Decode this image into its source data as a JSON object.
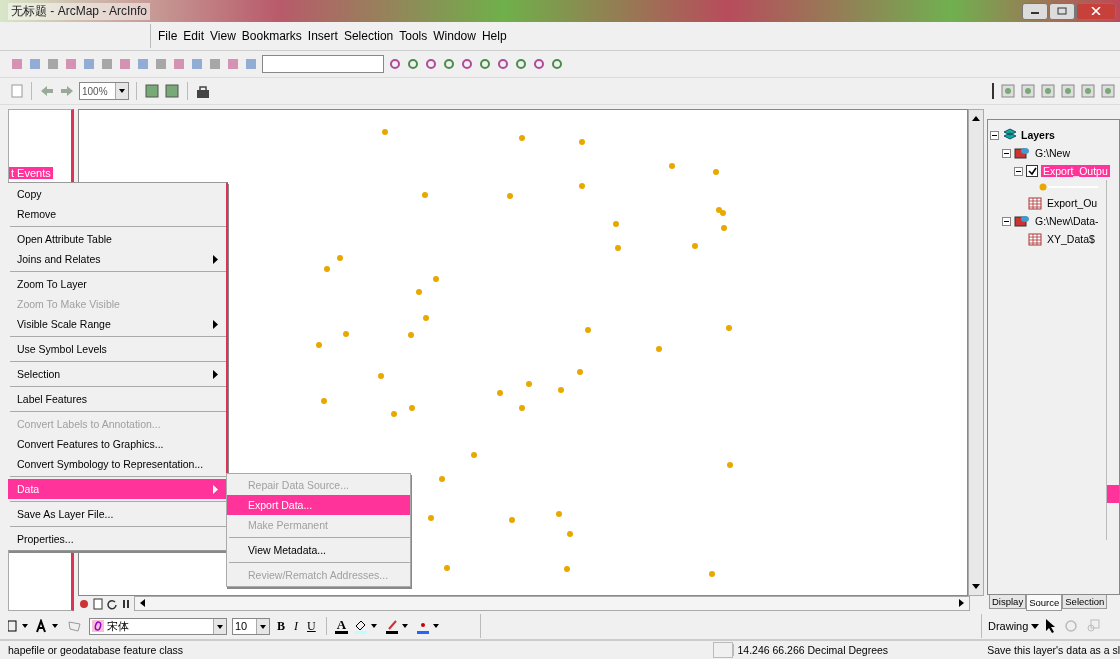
{
  "window": {
    "title": "无标题 - ArcMap - ArcInfo"
  },
  "menu_bar": [
    {
      "label": "File"
    },
    {
      "label": "Edit"
    },
    {
      "label": "View"
    },
    {
      "label": "Bookmarks"
    },
    {
      "label": "Insert"
    },
    {
      "label": "Selection"
    },
    {
      "label": "Tools"
    },
    {
      "label": "Window"
    },
    {
      "label": "Help"
    }
  ],
  "layout_toolbar": {
    "zoom_percent": "100%"
  },
  "left_toc": {
    "item": "t Events",
    "selected": true
  },
  "context_menu": [
    {
      "kind": "item",
      "label": "Copy",
      "disabled": false,
      "submenu": false,
      "selected": false
    },
    {
      "kind": "item",
      "label": "Remove",
      "disabled": false,
      "submenu": false,
      "selected": false
    },
    {
      "kind": "separator"
    },
    {
      "kind": "item",
      "label": "Open Attribute Table",
      "disabled": false,
      "submenu": false,
      "selected": false
    },
    {
      "kind": "item",
      "label": "Joins and Relates",
      "disabled": false,
      "submenu": true,
      "selected": false
    },
    {
      "kind": "separator"
    },
    {
      "kind": "item",
      "label": "Zoom To Layer",
      "disabled": false,
      "submenu": false,
      "selected": false
    },
    {
      "kind": "item",
      "label": "Zoom To Make Visible",
      "disabled": true,
      "submenu": false,
      "selected": false
    },
    {
      "kind": "item",
      "label": "Visible Scale Range",
      "disabled": false,
      "submenu": true,
      "selected": false
    },
    {
      "kind": "separator"
    },
    {
      "kind": "item",
      "label": "Use Symbol Levels",
      "disabled": false,
      "submenu": false,
      "selected": false
    },
    {
      "kind": "separator"
    },
    {
      "kind": "item",
      "label": "Selection",
      "disabled": false,
      "submenu": true,
      "selected": false
    },
    {
      "kind": "separator"
    },
    {
      "kind": "item",
      "label": "Label Features",
      "disabled": false,
      "submenu": false,
      "selected": false
    },
    {
      "kind": "separator"
    },
    {
      "kind": "item",
      "label": "Convert Labels to Annotation...",
      "disabled": true,
      "submenu": false,
      "selected": false
    },
    {
      "kind": "item",
      "label": "Convert Features to Graphics...",
      "disabled": false,
      "submenu": false,
      "selected": false
    },
    {
      "kind": "item",
      "label": "Convert Symbology to Representation...",
      "disabled": false,
      "submenu": false,
      "selected": false
    },
    {
      "kind": "separator"
    },
    {
      "kind": "item",
      "label": "Data",
      "disabled": false,
      "submenu": true,
      "selected": true
    },
    {
      "kind": "separator"
    },
    {
      "kind": "item",
      "label": "Save As Layer File...",
      "disabled": false,
      "submenu": false,
      "selected": false
    },
    {
      "kind": "separator"
    },
    {
      "kind": "item",
      "label": "Properties...",
      "disabled": false,
      "submenu": false,
      "selected": false
    }
  ],
  "submenu": [
    {
      "kind": "item",
      "label": "Repair Data Source...",
      "disabled": true,
      "selected": false
    },
    {
      "kind": "item",
      "label": "Export Data...",
      "disabled": false,
      "selected": true
    },
    {
      "kind": "item",
      "label": "Make Permanent",
      "disabled": true,
      "selected": false
    },
    {
      "kind": "separator"
    },
    {
      "kind": "item",
      "label": "View Metadata...",
      "disabled": false,
      "selected": false
    },
    {
      "kind": "separator"
    },
    {
      "kind": "item",
      "label": "Review/Rematch Addresses...",
      "disabled": true,
      "selected": false
    }
  ],
  "toc": {
    "root": "Layers",
    "children": [
      {
        "kind": "database",
        "label": "G:\\New",
        "expanded": true,
        "children": [
          {
            "kind": "layer",
            "label": "Export_Outpu",
            "checked": true,
            "selected": true,
            "expanded": true
          },
          {
            "kind": "table",
            "label": "Export_Ou"
          }
        ]
      },
      {
        "kind": "database",
        "label": "G:\\New\\Data-",
        "expanded": true,
        "children": [
          {
            "kind": "table",
            "label": "XY_Data$"
          }
        ]
      }
    ]
  },
  "toc_tabs": [
    {
      "label": "Display",
      "selected": false
    },
    {
      "label": "Source",
      "selected": true
    },
    {
      "label": "Selection",
      "selected": false
    }
  ],
  "draw_toolbar": {
    "font": "宋体",
    "size": "10",
    "bold": "B",
    "italic": "I",
    "underline": "U",
    "font_color": "A"
  },
  "drawing_menu": "Drawing",
  "status_bar": {
    "message": "hapefile or geodatabase feature class",
    "coordinates": "14.246  66.266 Decimal Degrees",
    "tip": "Save this layer's data as a sl"
  }
}
